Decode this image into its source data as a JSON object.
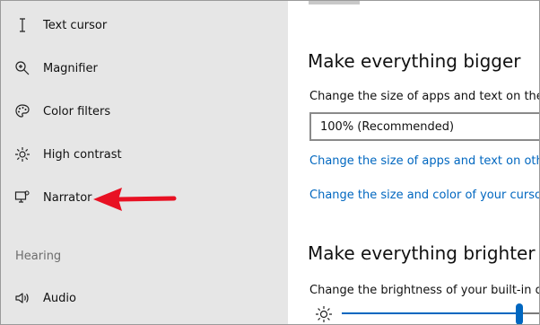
{
  "sidebar": {
    "items": [
      {
        "label": "Text cursor",
        "icon": "text-cursor-icon"
      },
      {
        "label": "Magnifier",
        "icon": "magnifier-icon"
      },
      {
        "label": "Color filters",
        "icon": "color-palette-icon"
      },
      {
        "label": "High contrast",
        "icon": "high-contrast-icon"
      },
      {
        "label": "Narrator",
        "icon": "narrator-icon"
      }
    ],
    "section_hearing": "Hearing",
    "hearing_items": [
      {
        "label": "Audio",
        "icon": "speaker-icon"
      }
    ]
  },
  "annotation": {
    "type": "arrow",
    "color": "#e81123",
    "points_to": "Narrator"
  },
  "main": {
    "section1_title": "Make everything bigger",
    "section1_desc": "Change the size of apps and text on the m",
    "scale_dropdown_value": "100% (Recommended)",
    "link_text_size": "Change the size of apps and text on other",
    "link_cursor": "Change the size and color of your cursor a",
    "section2_title": "Make everything brighter",
    "section2_desc": "Change the brightness of your built-in dis",
    "brightness": 0.75
  },
  "colors": {
    "sidebar_bg": "#e6e6e6",
    "accent": "#0067c0",
    "link": "#0067c0"
  }
}
